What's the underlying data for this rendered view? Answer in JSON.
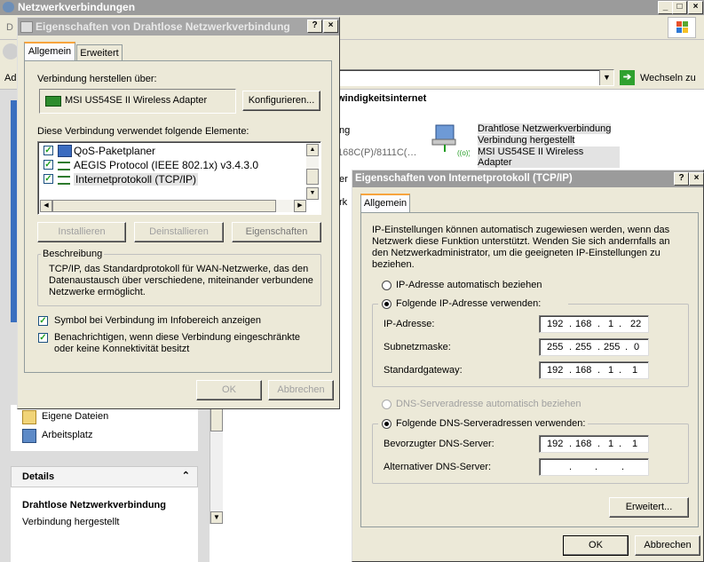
{
  "main_window": {
    "title": "Netzwerkverbindungen",
    "menu_hint": "D",
    "address_label": "Ad",
    "go_label": "Wechseln zu",
    "section_title": "windigkeitsinternet",
    "partial_text_1": "ng",
    "partial_text_2": "168C(P)/8111C(…",
    "partial_text_3": "er",
    "partial_text_4": "rk"
  },
  "connection_tile": {
    "name": "Drahtlose Netzwerkverbindung",
    "status": "Verbindung hergestellt",
    "adapter": "MSI US54SE II Wireless Adapter"
  },
  "left_panel": {
    "links": [
      "Eigene Dateien",
      "Arbeitsplatz"
    ],
    "details_title": "Details",
    "details_name": "Drahtlose Netzwerkverbindung",
    "details_status": "Verbindung hergestellt"
  },
  "props_dialog": {
    "title": "Eigenschaften von Drahtlose Netzwerkverbindung",
    "tabs": [
      "Allgemein",
      "Erweitert"
    ],
    "connect_via_label": "Verbindung herstellen über:",
    "adapter_name": "MSI US54SE II Wireless Adapter",
    "configure_button": "Konfigurieren...",
    "elements_label": "Diese Verbindung verwendet folgende Elemente:",
    "elements": [
      "QoS-Paketplaner",
      "AEGIS Protocol (IEEE 802.1x) v3.4.3.0",
      "Internetprotokoll (TCP/IP)"
    ],
    "install_button": "Installieren",
    "uninstall_button": "Deinstallieren",
    "properties_button": "Eigenschaften",
    "description_label": "Beschreibung",
    "description_text": "TCP/IP, das Standardprotokoll für WAN-Netzwerke, das den Datenaustausch über verschiedene, miteinander verbundene Netzwerke ermöglicht.",
    "show_icon_label": "Symbol bei Verbindung im Infobereich anzeigen",
    "notify_label": "Benachrichtigen, wenn diese Verbindung eingeschränkte oder keine Konnektivität besitzt",
    "ok_button": "OK",
    "cancel_button": "Abbrechen"
  },
  "tcpip_dialog": {
    "title": "Eigenschaften von Internetprotokoll (TCP/IP)",
    "tab": "Allgemein",
    "intro": "IP-Einstellungen können automatisch zugewiesen werden, wenn das Netzwerk diese Funktion unterstützt. Wenden Sie sich andernfalls an den Netzwerkadministrator, um die geeigneten IP-Einstellungen zu beziehen.",
    "auto_ip_label": "IP-Adresse automatisch beziehen",
    "manual_ip_label": "Folgende IP-Adresse verwenden:",
    "ip_label": "IP-Adresse:",
    "ip": [
      "192",
      "168",
      "1",
      "22"
    ],
    "mask_label": "Subnetzmaske:",
    "mask": [
      "255",
      "255",
      "255",
      "0"
    ],
    "gateway_label": "Standardgateway:",
    "gateway": [
      "192",
      "168",
      "1",
      "1"
    ],
    "auto_dns_label": "DNS-Serveradresse automatisch beziehen",
    "manual_dns_label": "Folgende DNS-Serveradressen verwenden:",
    "pref_dns_label": "Bevorzugter DNS-Server:",
    "pref_dns": [
      "192",
      "168",
      "1",
      "1"
    ],
    "alt_dns_label": "Alternativer DNS-Server:",
    "advanced_button": "Erweitert...",
    "ok_button": "OK",
    "cancel_button": "Abbrechen"
  },
  "colors": {
    "title_active": "#9b9b9b",
    "dialog_bg": "#ece9d8",
    "accent_green": "#21a121"
  }
}
